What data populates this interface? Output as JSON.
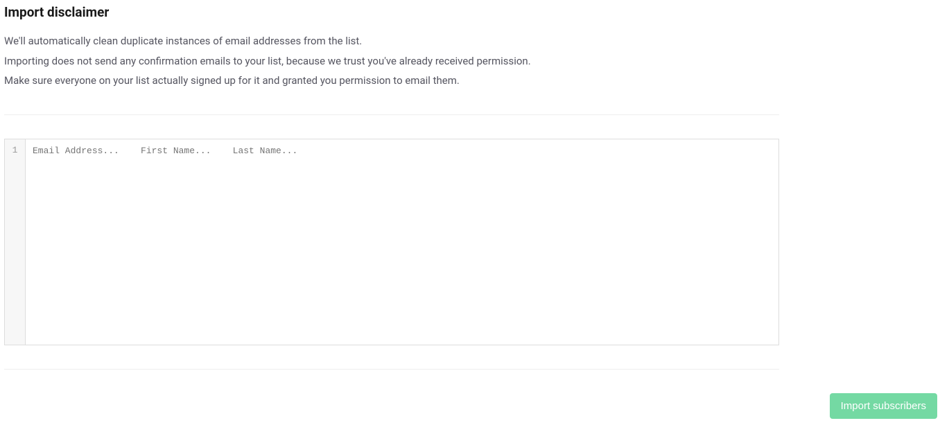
{
  "heading": "Import disclaimer",
  "disclaimer": {
    "line1": "We'll automatically clean duplicate instances of email addresses from the list.",
    "line2": "Importing does not send any confirmation emails to your list, because we trust you've already received permission.",
    "line3": "Make sure everyone on your list actually signed up for it and granted you permission to email them."
  },
  "editor": {
    "line_number": "1",
    "placeholder": "Email Address...    First Name...    Last Name..."
  },
  "actions": {
    "import_label": "Import subscribers"
  }
}
